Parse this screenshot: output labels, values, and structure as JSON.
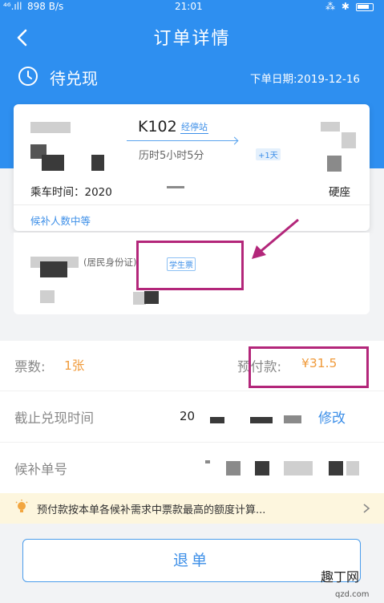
{
  "status_bar": {
    "signal": "⁴⁶.ıll",
    "speed": "898 B/s",
    "time": "21:01",
    "icons": "⁂ ✱"
  },
  "header": {
    "title": "订单详情",
    "status": "待兑现",
    "order_date": "下单日期:2019-12-16"
  },
  "train": {
    "number": "K102",
    "via_label": "经停站",
    "duration": "历时5小时5分",
    "plus_day": "+1天",
    "ride_time": "乘车时间：2020",
    "seat_type": "硬座",
    "queue_status": "候补人数中等"
  },
  "passenger": {
    "id_type": "(居民身份证)",
    "ticket_tag": "学生票"
  },
  "details": {
    "ticket_count_label": "票数:",
    "ticket_count_value": "1张",
    "prepay_label": "预付款:",
    "prepay_value": "¥31.5",
    "deadline_label": "截止兑现时间",
    "deadline_value": "20",
    "modify_label": "修改",
    "queue_no_label": "候补单号"
  },
  "notice": {
    "text": "预付款按本单各候补需求中票款最高的额度计算..."
  },
  "actions": {
    "cancel_label": "退单"
  },
  "watermark": {
    "brand": "趣丁网",
    "site": "qzd.com"
  },
  "colors": {
    "header_blue": "#2e8ff0",
    "accent_blue": "#3d8fe8",
    "price_orange": "#f09a3a",
    "highlight_magenta": "#b3267a",
    "notice_bg": "#fdf6de"
  }
}
